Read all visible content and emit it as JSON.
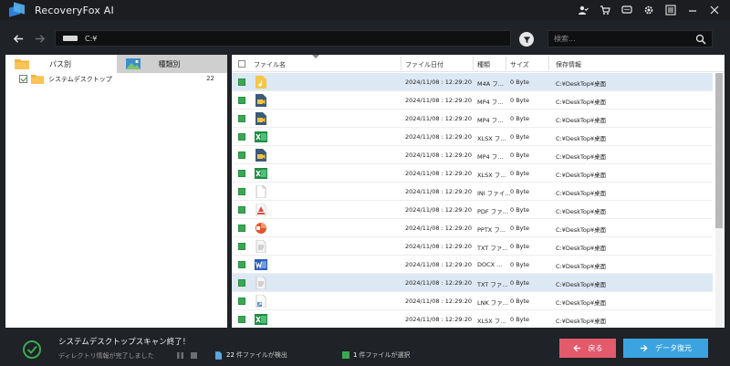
{
  "app": {
    "title": "RecoveryFox AI"
  },
  "toolbar": {
    "path": "C:¥",
    "search_placeholder": "検索..."
  },
  "left_panel": {
    "tabs": [
      {
        "label": "パス別"
      },
      {
        "label": "種類別"
      }
    ],
    "tree": {
      "label": "システムデスクトップ",
      "count": "22"
    }
  },
  "file_list": {
    "headers": {
      "name": "ファイル名",
      "date": "ファイル日付",
      "type": "種類",
      "size": "サイズ",
      "info": "保存情報"
    },
    "rows": [
      {
        "icon": "audio-file-icon",
        "date": "2024/11/08 : 12:29:20",
        "type": "M4A フ...",
        "size": "0 Byte",
        "info": "C:¥DeskTop¥桌面",
        "selected": true
      },
      {
        "icon": "video-file-icon",
        "date": "2024/11/08 : 12:29:20",
        "type": "MP4 フ...",
        "size": "0 Byte",
        "info": "C:¥DeskTop¥桌面",
        "selected": false
      },
      {
        "icon": "video-file-icon",
        "date": "2024/11/08 : 12:29:20",
        "type": "MP4 フ...",
        "size": "0 Byte",
        "info": "C:¥DeskTop¥桌面",
        "selected": false
      },
      {
        "icon": "excel-file-icon",
        "date": "2024/11/08 : 12:29:20",
        "type": "XLSX フ...",
        "size": "0 Byte",
        "info": "C:¥DeskTop¥桌面",
        "selected": false
      },
      {
        "icon": "video-file-icon",
        "date": "2024/11/08 : 12:29:20",
        "type": "MP4 フ...",
        "size": "0 Byte",
        "info": "C:¥DeskTop¥桌面",
        "selected": false
      },
      {
        "icon": "excel-file-icon",
        "date": "2024/11/08 : 12:29:20",
        "type": "XLSX フ...",
        "size": "0 Byte",
        "info": "C:¥DeskTop¥桌面",
        "selected": false
      },
      {
        "icon": "generic-file-icon",
        "date": "2024/11/08 : 12:29:20",
        "type": "INI ファイ...",
        "size": "0 Byte",
        "info": "C:¥DeskTop¥桌面",
        "selected": false
      },
      {
        "icon": "pdf-file-icon",
        "date": "2024/11/08 : 12:29:20",
        "type": "PDF ファ...",
        "size": "0 Byte",
        "info": "C:¥DeskTop¥桌面",
        "selected": false
      },
      {
        "icon": "powerpoint-file-icon",
        "date": "2024/11/08 : 12:29:20",
        "type": "PPTX フ...",
        "size": "0 Byte",
        "info": "C:¥DeskTop¥桌面",
        "selected": false
      },
      {
        "icon": "text-file-icon",
        "date": "2024/11/08 : 12:29:20",
        "type": "TXT ファ...",
        "size": "0 Byte",
        "info": "C:¥DeskTop¥桌面",
        "selected": false
      },
      {
        "icon": "word-file-icon",
        "date": "2024/11/08 : 12:29:20",
        "type": "DOCX ...",
        "size": "0 Byte",
        "info": "C:¥DeskTop¥桌面",
        "selected": false
      },
      {
        "icon": "text-file-icon",
        "date": "2024/11/08 : 12:29:20",
        "type": "TXT ファ...",
        "size": "0 Byte",
        "info": "C:¥DeskTop¥桌面",
        "selected": true
      },
      {
        "icon": "shortcut-file-icon",
        "date": "2024/11/08 : 12:29:20",
        "type": "LNK ファ...",
        "size": "0 Byte",
        "info": "C:¥DeskTop¥桌面",
        "selected": false
      },
      {
        "icon": "excel-file-icon",
        "date": "2024/11/08 : 12:29:20",
        "type": "XLSX フ...",
        "size": "0 Byte",
        "info": "C:¥DeskTop¥桌面",
        "selected": false
      }
    ]
  },
  "status": {
    "title": "システムデスクトップスキャン終了！",
    "subtitle": "ディレクトリ情報が完了しました",
    "found_count": "22",
    "found_label": "件ファイルが検出",
    "selected_count": "1",
    "selected_label": "件ファイルが選択"
  },
  "buttons": {
    "back": "戻る",
    "recover": "データ復元"
  },
  "colors": {
    "accent_blue": "#3ba4e0",
    "back_red": "#e25a6c",
    "check_green": "#3aa853",
    "selected_row": "#dde8f5"
  }
}
